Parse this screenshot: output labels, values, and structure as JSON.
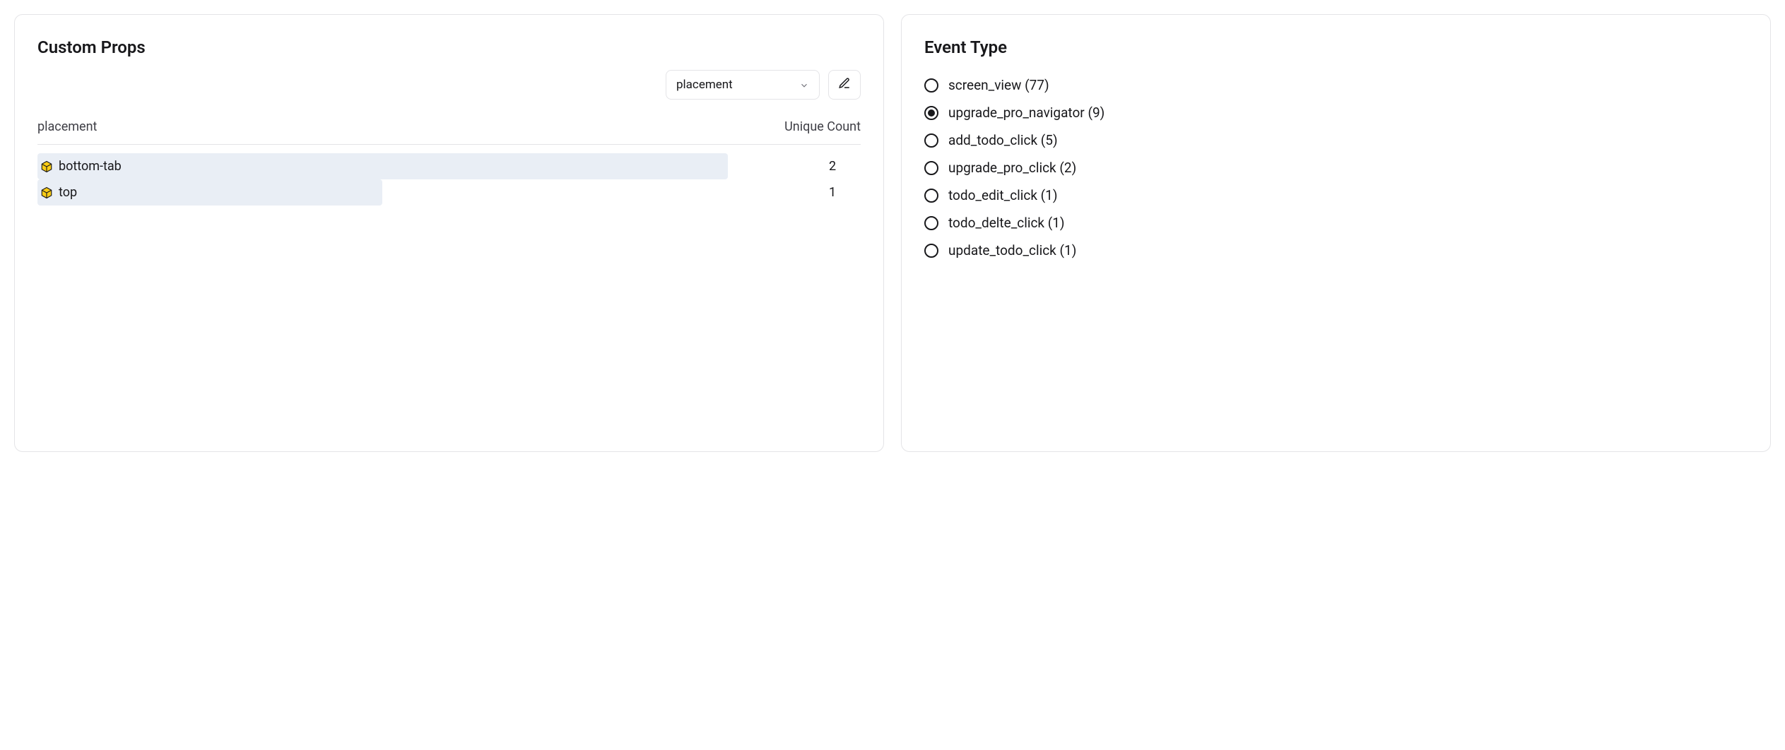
{
  "custom_props": {
    "title": "Custom Props",
    "dropdown_value": "placement",
    "table": {
      "col_label": "placement",
      "col_count": "Unique Count",
      "rows": [
        {
          "label": "bottom-tab",
          "count": "2",
          "bar_pct": 90
        },
        {
          "label": "top",
          "count": "1",
          "bar_pct": 45
        }
      ]
    }
  },
  "event_type": {
    "title": "Event Type",
    "items": [
      {
        "label": "screen_view (77)",
        "selected": false
      },
      {
        "label": "upgrade_pro_navigator (9)",
        "selected": true
      },
      {
        "label": "add_todo_click (5)",
        "selected": false
      },
      {
        "label": "upgrade_pro_click (2)",
        "selected": false
      },
      {
        "label": "todo_edit_click (1)",
        "selected": false
      },
      {
        "label": "todo_delte_click (1)",
        "selected": false
      },
      {
        "label": "update_todo_click (1)",
        "selected": false
      }
    ]
  }
}
